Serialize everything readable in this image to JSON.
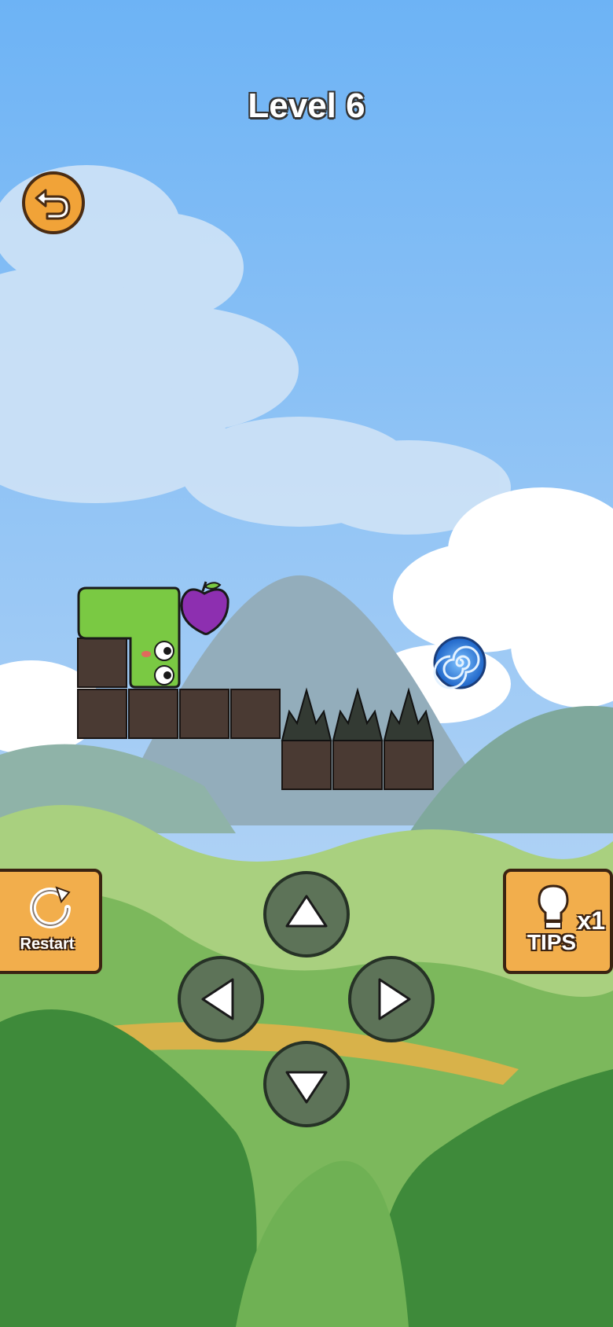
{
  "level": {
    "title": "Level 6"
  },
  "buttons": {
    "back": {
      "icon": "back-arrow-icon"
    },
    "restart": {
      "label": "Restart",
      "icon": "restart-icon"
    },
    "tips": {
      "label": "TIPS",
      "count": "x1",
      "icon": "lightbulb-icon"
    }
  },
  "dpad": {
    "up": {
      "icon": "arrow-up-icon"
    },
    "left": {
      "icon": "arrow-left-icon"
    },
    "right": {
      "icon": "arrow-right-icon"
    },
    "down": {
      "icon": "arrow-down-icon"
    }
  },
  "colors": {
    "sky_top": "#6db3f5",
    "sky_bottom": "#b9d8f7",
    "block": "#4a3a33",
    "snake": "#7ac943",
    "button_orange": "#f2ae4c",
    "apple": "#8d2fb0",
    "portal": "#2d7fe0"
  }
}
